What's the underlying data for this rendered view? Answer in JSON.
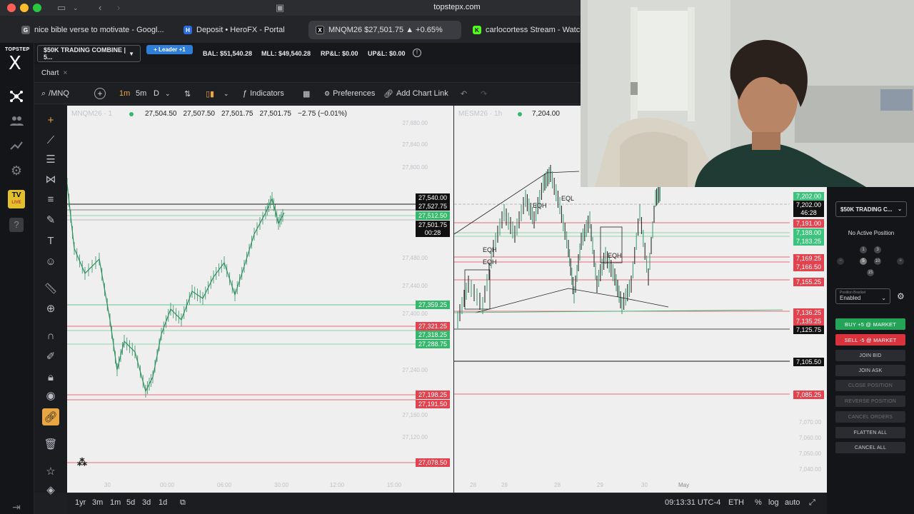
{
  "browser": {
    "url": "topstepx.com",
    "tabs": [
      {
        "label": "nice bible verse to motivate - Googl...",
        "icon_letter": "G",
        "icon_color": "#5f6368"
      },
      {
        "label": "Deposit  •  HeroFX - Portal",
        "icon_letter": "H",
        "icon_color": "#2d6cdf"
      },
      {
        "label": "MNQM26 $27,501.75 ▲ +0.65%",
        "icon_letter": "X",
        "icon_color": "#111111"
      },
      {
        "label": "carlocortess Stream - Watch L",
        "icon_letter": "K",
        "icon_color": "#53fc18"
      }
    ]
  },
  "brand": {
    "top": "TOPSTEP",
    "x": "X"
  },
  "account": {
    "selector": "$50K TRADING COMBINE | 5...",
    "leader": "+ Leader +1",
    "bal": "BAL: $51,540.28",
    "mll": "MLL: $49,540.28",
    "rpl": "RP&L: $0.00",
    "upl": "UP&L: $0.00"
  },
  "chart_tab": {
    "label": "Chart",
    "close": "×"
  },
  "toolbar": {
    "symbol": "/MNQ",
    "tf1": "1m",
    "tf2": "5m",
    "tf3": "D",
    "indicators": "Indicators",
    "preferences": "Preferences",
    "add_chart_link": "Add Chart Link"
  },
  "left_chart": {
    "symbol": "MNQM26 · 1",
    "ohlc": [
      "27,504.50",
      "27,507.50",
      "27,501.75",
      "27,501.75",
      "−2.75 (−0.01%)"
    ],
    "price_labels": [
      {
        "v": "27,540.00",
        "c": "k"
      },
      {
        "v": "27,527.75",
        "c": "k"
      },
      {
        "v": "27,512.50",
        "c": "g"
      },
      {
        "v": "27,501.75",
        "c": "k"
      },
      {
        "v": "00:28",
        "c": "k"
      },
      {
        "v": "27,359.25",
        "c": "g"
      },
      {
        "v": "27,321.25",
        "c": "r"
      },
      {
        "v": "27,318.25",
        "c": "g"
      },
      {
        "v": "27,288.75",
        "c": "g"
      },
      {
        "v": "27,198.25",
        "c": "r"
      },
      {
        "v": "27,191.50",
        "c": "r"
      },
      {
        "v": "27,078.50",
        "c": "r"
      }
    ],
    "axis_ticks": [
      "27,880.00",
      "27,840.00",
      "27,800.00",
      "27,480.00",
      "27,440.00",
      "27,400.00",
      "27,240.00",
      "27,160.00",
      "27,120.00"
    ],
    "time_ticks": [
      "30",
      "00:00",
      "06:00",
      "30:00",
      "12:00",
      "15:00"
    ]
  },
  "right_chart": {
    "symbol": "MESM26 · 1h",
    "price": "7,204.00",
    "price_labels": [
      {
        "v": "7,202.00",
        "c": "gr"
      },
      {
        "v": "7,202.00",
        "c": "k"
      },
      {
        "v": "46:28",
        "c": "k"
      },
      {
        "v": "7,191.00",
        "c": "r"
      },
      {
        "v": "7,188.00",
        "c": "gr"
      },
      {
        "v": "7,183.25",
        "c": "gr"
      },
      {
        "v": "7,169.25",
        "c": "r"
      },
      {
        "v": "7,166.50",
        "c": "r"
      },
      {
        "v": "7,155.25",
        "c": "r"
      },
      {
        "v": "7,136.25",
        "c": "r"
      },
      {
        "v": "7,135.25",
        "c": "r"
      },
      {
        "v": "7,125.75",
        "c": "k"
      },
      {
        "v": "7,105.50",
        "c": "k"
      },
      {
        "v": "7,085.25",
        "c": "r"
      }
    ],
    "axis_ticks": [
      "7,070.00",
      "7,060.00",
      "7,050.00",
      "7,040.00"
    ],
    "time_ticks": [
      "28",
      "28",
      "28",
      "29",
      "30",
      "May"
    ],
    "annotations": [
      "EQH",
      "EQH",
      "EQH",
      "EQL",
      "EQH"
    ]
  },
  "bottom": {
    "ranges": [
      "1yr",
      "3m",
      "1m",
      "5d",
      "3d",
      "1d"
    ],
    "clock": "09:13:31 UTC-4",
    "session": "ETH",
    "pct": "%",
    "log": "log",
    "auto": "auto"
  },
  "order_panel": {
    "account": "$50K TRADING C...",
    "no_position": "No Active Position",
    "qty_values": [
      "1",
      "3",
      "5",
      "10",
      "15"
    ],
    "bracket_label": "Position Bracket",
    "bracket_value": "Enabled",
    "buy": "BUY +5 @ MARKET",
    "sell": "SELL -5 @ MARKET",
    "join_bid": "JOIN BID",
    "join_ask": "JOIN ASK",
    "close_position": "CLOSE POSITION",
    "reverse_position": "REVERSE POSITION",
    "cancel_orders": "CANCEL ORDERS",
    "flatten_all": "FLATTEN ALL",
    "cancel_all": "CANCEL ALL"
  },
  "colors": {
    "buy": "#23a457",
    "sell": "#d8323c",
    "accent": "#2f7fd8",
    "live": "#e2c02b"
  }
}
